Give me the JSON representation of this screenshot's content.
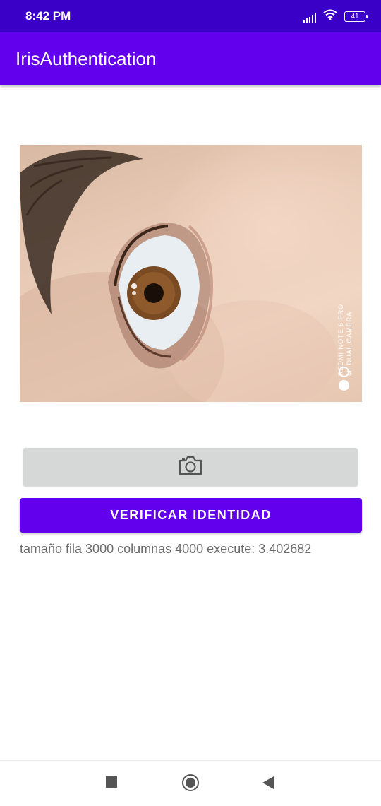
{
  "status_bar": {
    "time": "8:42 PM",
    "battery": "41",
    "icons": [
      "signal-icon",
      "wifi-icon",
      "battery-icon"
    ]
  },
  "app_bar": {
    "title": "IrisAuthentication"
  },
  "photo": {
    "watermark_line1": "REDMI NOTE 6 PRO",
    "watermark_line2": "MI DUAL CAMERA"
  },
  "camera_button": {
    "icon": "camera-icon"
  },
  "verify_button": {
    "label": "VERIFICAR IDENTIDAD"
  },
  "result": {
    "text": "tamaño fila 3000 columnas 4000 execute: 3.402682"
  },
  "nav_bar": {
    "icons": [
      "recent-apps-icon",
      "home-icon",
      "back-icon"
    ]
  },
  "colors": {
    "status_bar": "#3a00c8",
    "app_bar": "#6200ee",
    "primary_button": "#6200ee",
    "secondary_button": "#d6d7d7",
    "result_text": "#6b6b6b"
  }
}
